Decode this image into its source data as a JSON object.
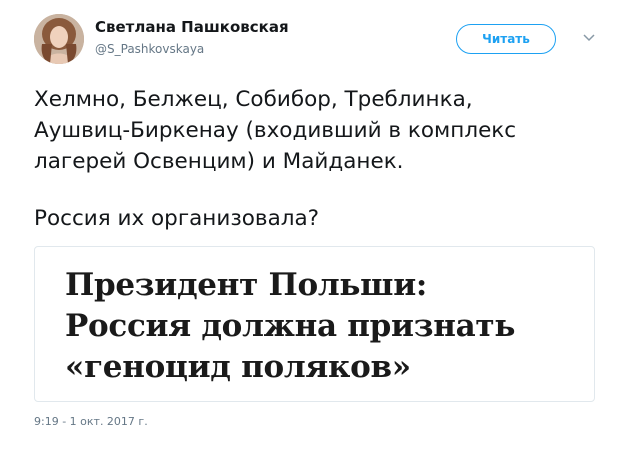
{
  "tweet": {
    "author_name": "Светлана Пашковская",
    "author_handle": "@S_Pashkovskaya",
    "follow_label": "Читать",
    "text_lines": [
      "Хелмно, Белжец, Собибор, Треблинка,",
      "Аушвиц-Биркенау (входивший в комплекс",
      "лагерей Освенцим) и Майданек.",
      "Россия их организовала?"
    ],
    "timestamp": "9:19 - 1 окт. 2017 г."
  },
  "media": {
    "headline_lines": [
      "Президент Польши:",
      "Россия должна признать",
      "«геноцид поляков»"
    ]
  },
  "icons": {
    "menu_caret": "chevron-down-icon",
    "avatar": "user-avatar-photo"
  },
  "colors": {
    "accent": "#1da1f2",
    "text_primary": "#14171a",
    "text_secondary": "#657786",
    "border": "#e1e8ed"
  }
}
